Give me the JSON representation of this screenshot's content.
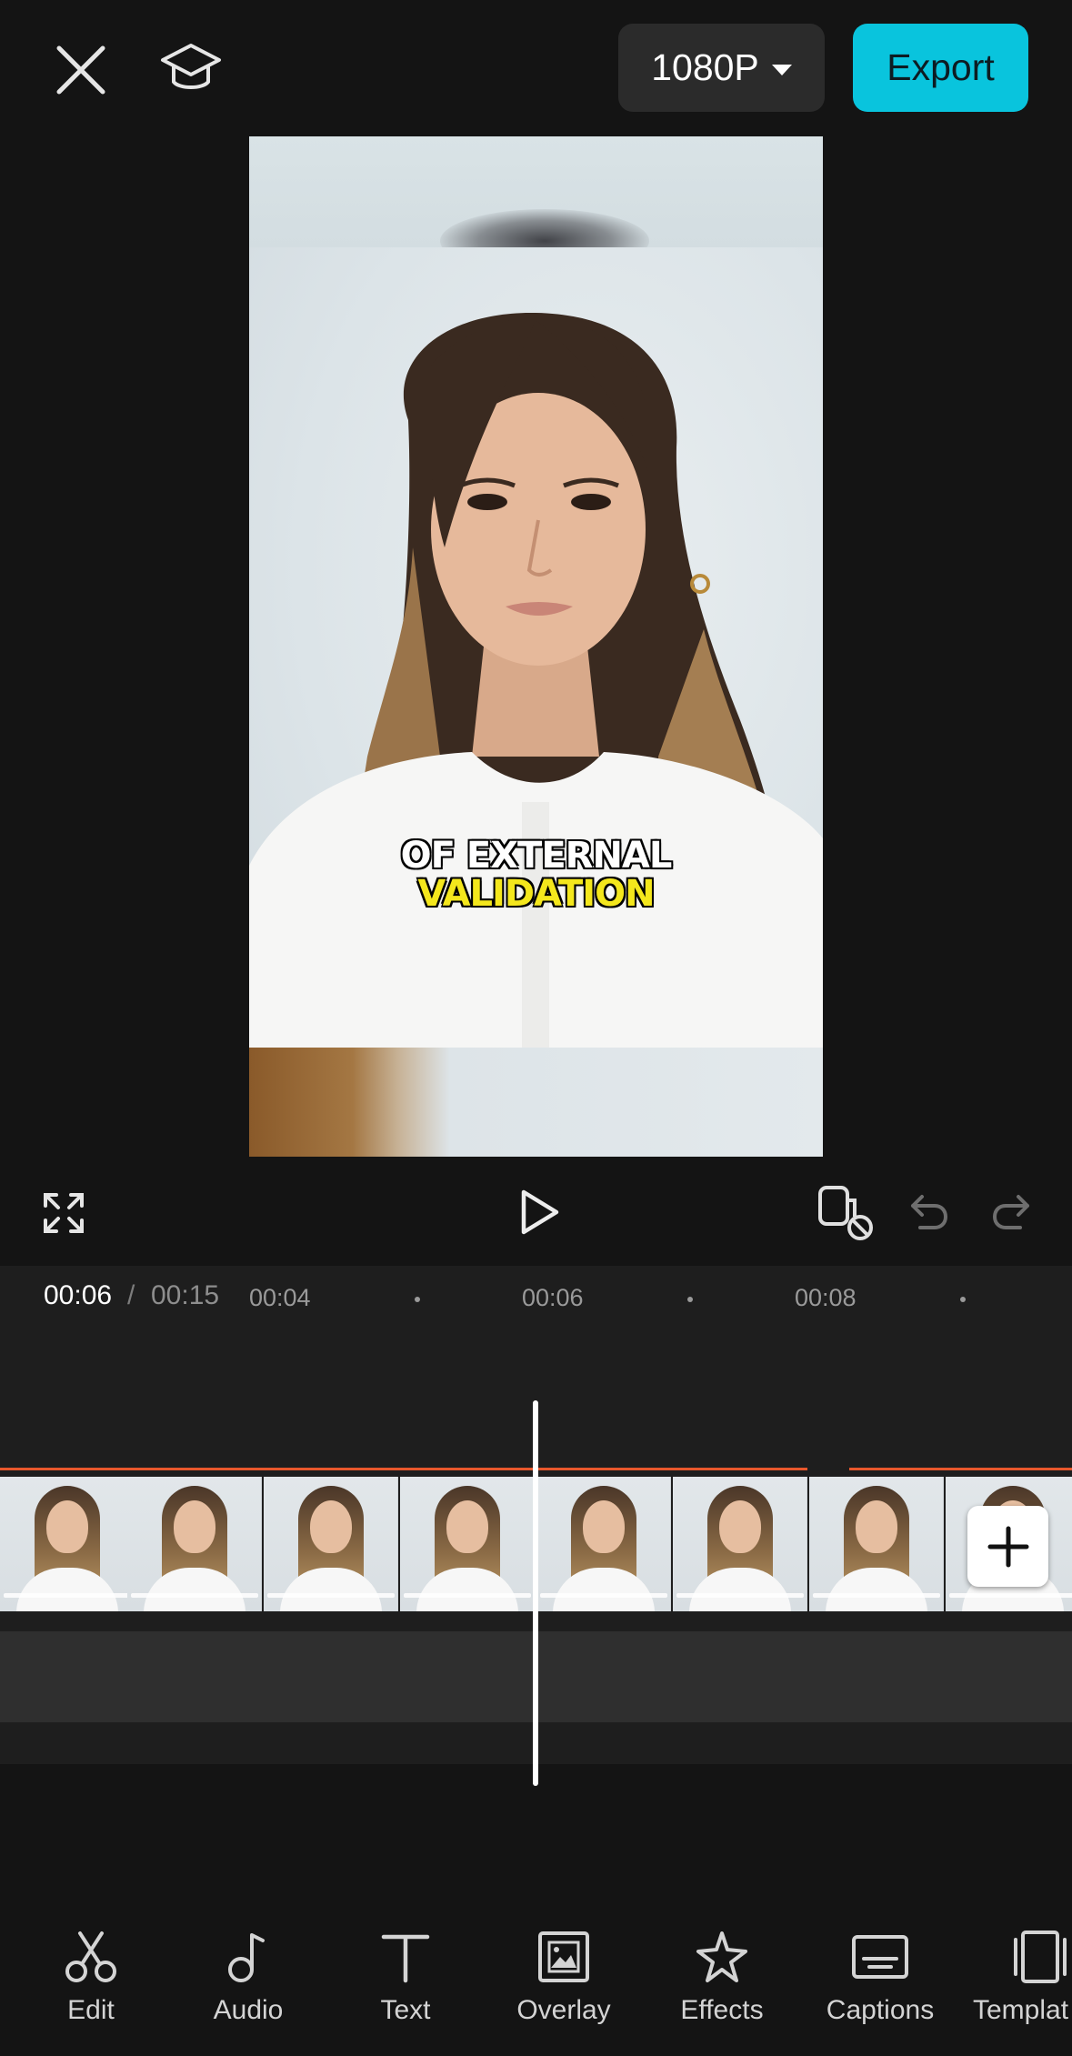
{
  "header": {
    "resolution_label": "1080P",
    "export_label": "Export"
  },
  "preview": {
    "caption_line1": "OF EXTERNAL",
    "caption_line2": "VALIDATION",
    "caption_line2_color": "#f4e71c"
  },
  "timeline": {
    "current_time": "00:06",
    "separator": "/",
    "total_time": "00:15",
    "ticks": [
      "00:04",
      "00:06",
      "00:08"
    ],
    "audio_color": "#e8572c"
  },
  "toolbar": {
    "items": [
      {
        "label": "Edit",
        "icon": "scissors-icon"
      },
      {
        "label": "Audio",
        "icon": "music-note-icon"
      },
      {
        "label": "Text",
        "icon": "text-icon"
      },
      {
        "label": "Overlay",
        "icon": "overlay-icon"
      },
      {
        "label": "Effects",
        "icon": "effects-star-icon"
      },
      {
        "label": "Captions",
        "icon": "captions-icon"
      },
      {
        "label": "Templat",
        "icon": "template-icon"
      }
    ]
  },
  "colors": {
    "background": "#141414",
    "accent": "#09c4dd",
    "panel": "#2b2b2b"
  }
}
